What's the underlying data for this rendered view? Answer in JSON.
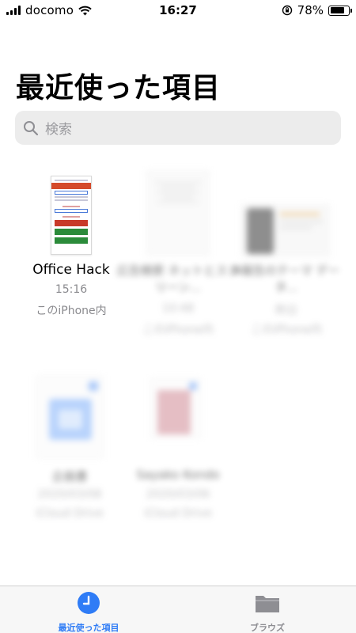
{
  "status": {
    "carrier": "docomo",
    "time": "16:27",
    "battery_pct": "78%",
    "battery_level": 0.78
  },
  "page_title": "最近使った項目",
  "search": {
    "placeholder": "検索"
  },
  "files": [
    {
      "name": "Office Hack",
      "time": "15:16",
      "location": "このiPhone内"
    },
    {
      "name": "広告検索 ネットとスクリーン...",
      "time": "10:48",
      "location": "このiPhone内"
    },
    {
      "name": "A報告のテーマ データ...",
      "time": "昨日",
      "location": "このiPhone内"
    },
    {
      "name": "企画書",
      "time": "2020/03/08",
      "location": "iCloud Drive"
    },
    {
      "name": "Sayako Kondo",
      "time": "2020/03/06",
      "location": "iCloud Drive"
    }
  ],
  "thumb_office_hack": {
    "header": "Office Hack"
  },
  "tabs": [
    {
      "label": "最近使った項目",
      "icon": "clock-icon",
      "active": true
    },
    {
      "label": "ブラウズ",
      "icon": "folder-icon",
      "active": false
    }
  ],
  "colors": {
    "accent": "#2f7cf6",
    "tab_inactive": "#8e8e93",
    "search_bg": "#ececec"
  }
}
